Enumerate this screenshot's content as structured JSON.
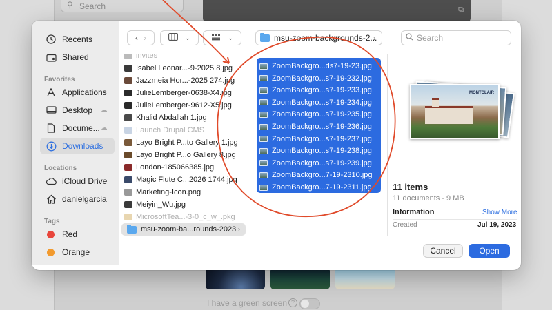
{
  "background": {
    "search_placeholder": "Search",
    "green_screen_label": "I have a green screen"
  },
  "toolbar": {
    "back_icon": "chevron-left",
    "forward_icon": "chevron-right",
    "path_label": "msu-zoom-backgrounds-2...",
    "search_placeholder": "Search"
  },
  "sidebar": {
    "items_top": [
      {
        "label": "Recents",
        "icon": "clock-icon"
      },
      {
        "label": "Shared",
        "icon": "shared-folder-icon"
      }
    ],
    "favorites_header": "Favorites",
    "favorites": [
      {
        "label": "Applications",
        "icon": "applications-icon"
      },
      {
        "label": "Desktop",
        "icon": "desktop-icon"
      },
      {
        "label": "Docume...",
        "icon": "document-icon"
      },
      {
        "label": "Downloads",
        "icon": "downloads-icon"
      }
    ],
    "locations_header": "Locations",
    "locations": [
      {
        "label": "iCloud Drive",
        "icon": "icloud-icon"
      },
      {
        "label": "danielgarcia",
        "icon": "home-icon"
      }
    ],
    "tags_header": "Tags",
    "tags": [
      {
        "label": "Red",
        "color": "#e8463c"
      },
      {
        "label": "Orange",
        "color": "#f29a2e"
      }
    ]
  },
  "files_column": [
    {
      "name": "invites",
      "dim": true,
      "color": "#bbbbbb"
    },
    {
      "name": "Isabel Leonar...-9-2025 8.jpg",
      "dim": false,
      "color": "#3a3a3a"
    },
    {
      "name": "Jazzmeia Hor...-2025 274.jpg",
      "dim": false,
      "color": "#6a4a3a"
    },
    {
      "name": "JulieLemberger-0638-X4.jpg",
      "dim": false,
      "color": "#2a2a2a"
    },
    {
      "name": "JulieLemberger-9612-X5.jpg",
      "dim": false,
      "color": "#2a2a2a"
    },
    {
      "name": "Khalid Abdallah 1.jpg",
      "dim": false,
      "color": "#4a4a4a"
    },
    {
      "name": "Launch Drupal CMS",
      "dim": true,
      "color": "#c8d4e4"
    },
    {
      "name": "Layo Bright P...to Gallery 1.jpg",
      "dim": false,
      "color": "#7a5a3a"
    },
    {
      "name": "Layo Bright P...o Gallery 8.jpg",
      "dim": false,
      "color": "#6a4a2a"
    },
    {
      "name": "London-185066385.jpg",
      "dim": false,
      "color": "#8a2a2a"
    },
    {
      "name": "Magic Flute C...2026 1744.jpg",
      "dim": false,
      "color": "#3a4a6a"
    },
    {
      "name": "Marketing-Icon.png",
      "dim": false,
      "color": "#999999"
    },
    {
      "name": "Meiyin_Wu.jpg",
      "dim": false,
      "color": "#3a3a3a"
    },
    {
      "name": "MicrosoftTea...-3-0_c_w_.pkg",
      "dim": true,
      "color": "#e8d6b0"
    },
    {
      "name": "msu-zoom-ba...rounds-2023",
      "dim": false,
      "color": "#5aa8ee",
      "folder": true
    }
  ],
  "selected_files": [
    "ZoomBackgro...ds7-19-23.jpg",
    "ZoomBackgro...s7-19-232.jpg",
    "ZoomBackgro...s7-19-233.jpg",
    "ZoomBackgro...s7-19-234.jpg",
    "ZoomBackgro...s7-19-235.jpg",
    "ZoomBackgro...s7-19-236.jpg",
    "ZoomBackgro...s7-19-237.jpg",
    "ZoomBackgro...s7-19-238.jpg",
    "ZoomBackgro...s7-19-239.jpg",
    "ZoomBackgro...7-19-2310.jpg",
    "ZoomBackgro...7-19-2311.jpg"
  ],
  "preview": {
    "logo_text": "MONTCLAIR",
    "item_count": "11 items",
    "summary": "11 documents - 9 MB",
    "info_label": "Information",
    "show_more": "Show More",
    "created_label": "Created",
    "created_value": "Jul 19, 2023"
  },
  "buttons": {
    "cancel": "Cancel",
    "open": "Open"
  },
  "annotation_color": "#e04a2a"
}
